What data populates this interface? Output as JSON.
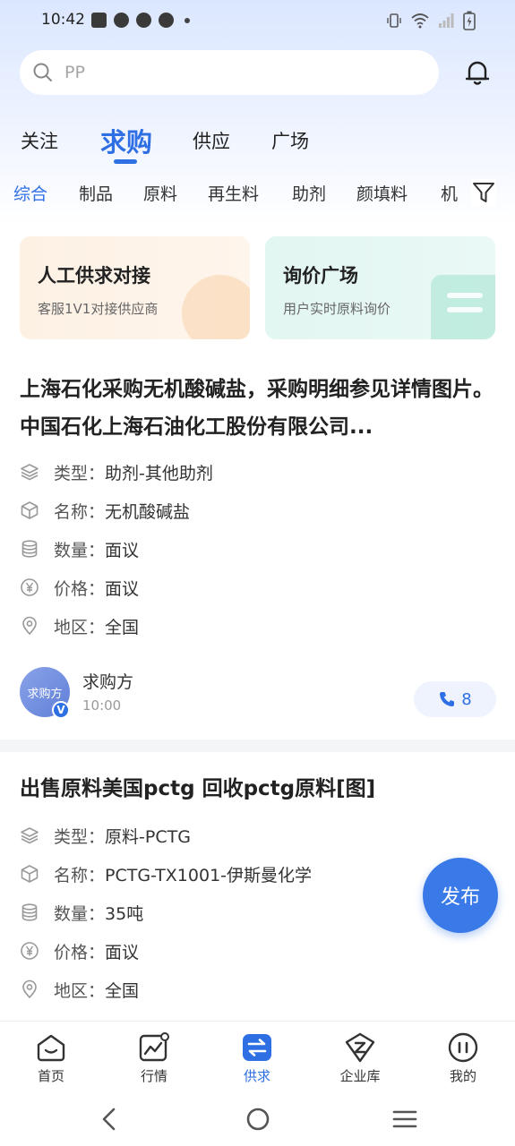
{
  "status_bar": {
    "time": "10:42"
  },
  "search": {
    "placeholder": "PP"
  },
  "main_tabs": [
    {
      "label": "关注"
    },
    {
      "label": "求购"
    },
    {
      "label": "供应"
    },
    {
      "label": "广场"
    }
  ],
  "sub_tabs": [
    {
      "label": "综合"
    },
    {
      "label": "制品"
    },
    {
      "label": "原料"
    },
    {
      "label": "再生料"
    },
    {
      "label": "助剂"
    },
    {
      "label": "颜填料"
    },
    {
      "label": "机"
    }
  ],
  "promos": [
    {
      "title": "人工供求对接",
      "subtitle": "客服1V1对接供应商"
    },
    {
      "title": "询价广场",
      "subtitle": "用户实时原料询价"
    }
  ],
  "listings": [
    {
      "title": "上海石化采购无机酸碱盐，采购明细参见详情图片。中国石化上海石油化工股份有限公司...",
      "fields": [
        {
          "icon": "layers-icon",
          "label": "类型：",
          "value": "助剂-其他助剂"
        },
        {
          "icon": "cube-icon",
          "label": "名称：",
          "value": "无机酸碱盐"
        },
        {
          "icon": "database-icon",
          "label": "数量：",
          "value": "面议"
        },
        {
          "icon": "yen-icon",
          "label": "价格：",
          "value": "面议"
        },
        {
          "icon": "location-icon",
          "label": "地区：",
          "value": "全国"
        }
      ],
      "poster": {
        "avatar_text": "求购方",
        "badge": "V",
        "name": "求购方",
        "time": "10:00"
      },
      "call_count": "8"
    },
    {
      "title": "出售原料美国pctg 回收pctg原料[图]",
      "fields": [
        {
          "icon": "layers-icon",
          "label": "类型：",
          "value": "原料-PCTG"
        },
        {
          "icon": "cube-icon",
          "label": "名称：",
          "value": "PCTG-TX1001-伊斯曼化学"
        },
        {
          "icon": "database-icon",
          "label": "数量：",
          "value": "35吨"
        },
        {
          "icon": "yen-icon",
          "label": "价格：",
          "value": "面议"
        },
        {
          "icon": "location-icon",
          "label": "地区：",
          "value": "全国"
        }
      ]
    }
  ],
  "fab": {
    "label": "发布"
  },
  "bottom_nav": [
    {
      "label": "首页",
      "icon": "home-icon"
    },
    {
      "label": "行情",
      "icon": "chart-icon"
    },
    {
      "label": "供求",
      "icon": "exchange-icon"
    },
    {
      "label": "企业库",
      "icon": "company-icon"
    },
    {
      "label": "我的",
      "icon": "profile-icon"
    }
  ],
  "colors": {
    "accent": "#2f6fe4",
    "fab": "#3a7ae8",
    "promo_orange": "#fdf1e4",
    "promo_teal": "#e2f6f2"
  }
}
